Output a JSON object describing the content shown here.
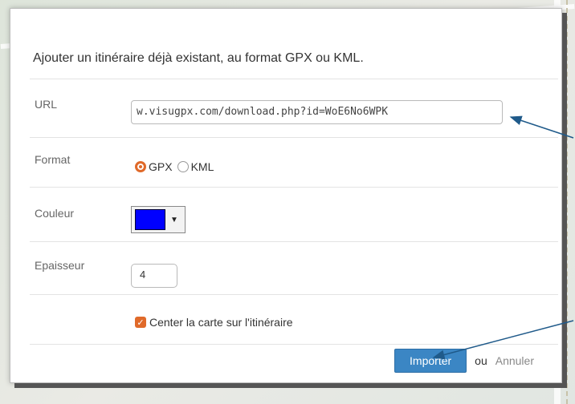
{
  "dialog": {
    "intro": "Ajouter un itinéraire déjà existant, au format GPX ou KML.",
    "url": {
      "label": "URL",
      "value": "w.visugpx.com/download.php?id=WoE6No6WPK"
    },
    "format": {
      "label": "Format",
      "options": [
        "GPX",
        "KML"
      ],
      "selected": "GPX"
    },
    "color": {
      "label": "Couleur",
      "value": "#0000ff"
    },
    "thickness": {
      "label": "Epaisseur",
      "value": "4"
    },
    "center": {
      "label": "Center la carte sur l'itinéraire",
      "checked": true
    },
    "footer": {
      "import_label": "Importer",
      "or_text": "ou",
      "cancel_label": "Annuler"
    }
  },
  "colors": {
    "accent": "#e06a2a",
    "primary": "#3b86c4"
  }
}
